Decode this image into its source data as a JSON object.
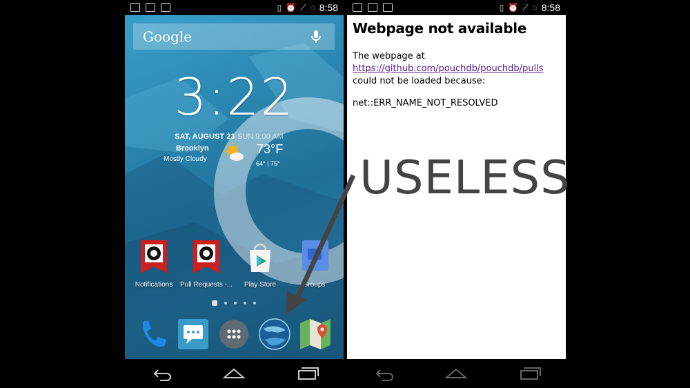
{
  "left_screen": {
    "status_time": "8:58",
    "search_label": "Google",
    "clock_time": "3:22",
    "date": "SAT, AUGUST 23",
    "alarm": "SUN 9:00 AM",
    "city": "Brooklyn",
    "condition": "Mostly Cloudy",
    "temperature": "73°F",
    "hi_lo": "64° | 75°",
    "apps": [
      {
        "label": "Notifications",
        "icon": "github-icon"
      },
      {
        "label": "Pull Requests -...",
        "icon": "github-icon"
      },
      {
        "label": "Play Store",
        "icon": "play-store-icon"
      },
      {
        "label": "Groups",
        "icon": "groups-icon"
      }
    ],
    "dock": [
      "phone-icon",
      "messaging-icon",
      "app-drawer-icon",
      "browser-globe-icon",
      "maps-icon"
    ]
  },
  "right_screen": {
    "status_time": "8:58",
    "title": "Webpage not available",
    "line1": "The webpage at",
    "url": "https://github.com/pouchdb/pouchdb/pulls",
    "line2": "could not be loaded because:",
    "error": "net::ERR_NAME_NOT_RESOLVED"
  },
  "annotation": "USELESS",
  "colors": {
    "link": "#551a8b",
    "annotation": "#444444",
    "github_red": "#cc1f1f"
  }
}
